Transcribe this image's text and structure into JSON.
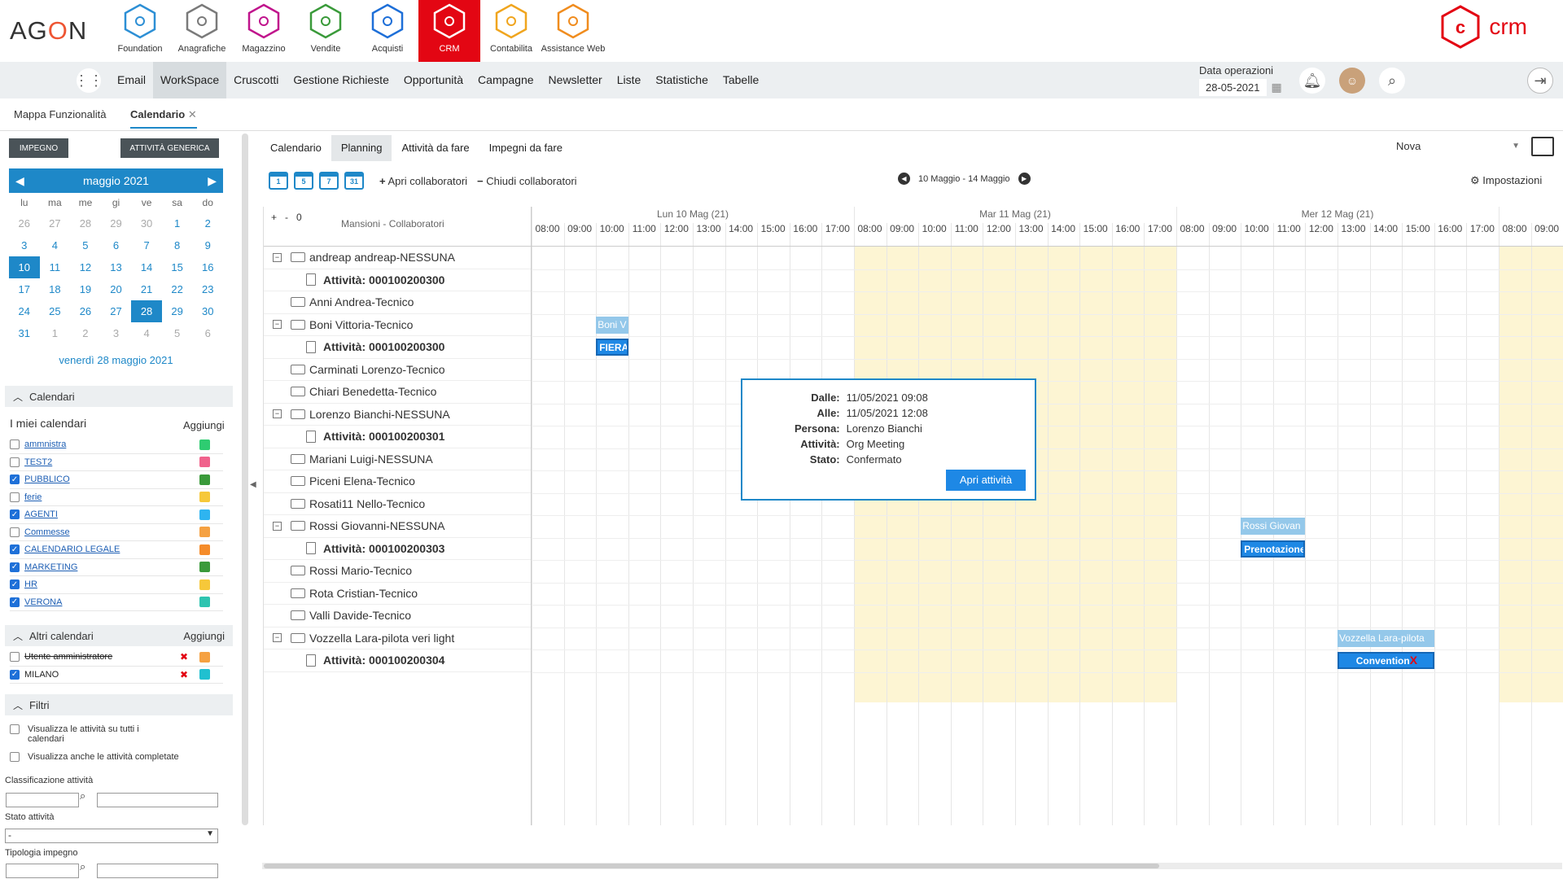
{
  "brand": {
    "logo": "AGON",
    "crm": "crm"
  },
  "modules": [
    {
      "label": "Foundation",
      "color": "#2d8fd5"
    },
    {
      "label": "Anagrafiche",
      "color": "#7a7a7a"
    },
    {
      "label": "Magazzino",
      "color": "#c0148c"
    },
    {
      "label": "Vendite",
      "color": "#3a9a3a"
    },
    {
      "label": "Acquisti",
      "color": "#1e6fd8"
    },
    {
      "label": "CRM",
      "color": "#ffffff"
    },
    {
      "label": "Contabilita",
      "color": "#f0a51e"
    },
    {
      "label": "Assistance Web",
      "color": "#f08c1e"
    }
  ],
  "menu": [
    "Email",
    "WorkSpace",
    "Cruscotti",
    "Gestione Richieste",
    "Opportunità",
    "Campagne",
    "Newsletter",
    "Liste",
    "Statistiche",
    "Tabelle"
  ],
  "data_operazioni": {
    "label": "Data operazioni",
    "value": "28-05-2021"
  },
  "tabs": [
    "Mappa Funzionalità",
    "Calendario"
  ],
  "buttons": {
    "impegno": "IMPEGNO",
    "attivita": "ATTIVITÀ GENERICA"
  },
  "minical": {
    "month": "maggio 2021",
    "daynames": [
      "lu",
      "ma",
      "me",
      "gi",
      "ve",
      "sa",
      "do"
    ],
    "days": [
      "26",
      "27",
      "28",
      "29",
      "30",
      "1",
      "2",
      "3",
      "4",
      "5",
      "6",
      "7",
      "8",
      "9",
      "10",
      "11",
      "12",
      "13",
      "14",
      "15",
      "16",
      "17",
      "18",
      "19",
      "20",
      "21",
      "22",
      "23",
      "24",
      "25",
      "26",
      "27",
      "28",
      "29",
      "30",
      "31",
      "1",
      "2",
      "3",
      "4",
      "5",
      "6"
    ],
    "footer": "venerdì 28 maggio 2021"
  },
  "sections": {
    "calendari": "Calendari",
    "miei": "I miei calendari",
    "aggiungi": "Aggiungi",
    "altri": "Altri calendari",
    "filtri": "Filtri"
  },
  "my_calendars": [
    {
      "name": "ammnistra",
      "checked": false,
      "color": "#2ecc71"
    },
    {
      "name": "TEST2",
      "checked": false,
      "color": "#f0628c"
    },
    {
      "name": "PUBBLICO",
      "checked": true,
      "color": "#3a9a3a"
    },
    {
      "name": "ferie",
      "checked": false,
      "color": "#f6c83a"
    },
    {
      "name": "AGENTI",
      "checked": true,
      "color": "#2eb4f0"
    },
    {
      "name": "Commesse",
      "checked": false,
      "color": "#f5a142"
    },
    {
      "name": "CALENDARIO LEGALE",
      "checked": true,
      "color": "#f58c2a"
    },
    {
      "name": "MARKETING",
      "checked": true,
      "color": "#3a9a3a"
    },
    {
      "name": "HR",
      "checked": true,
      "color": "#f6c83a"
    },
    {
      "name": "VERONA",
      "checked": true,
      "color": "#2ec4b0"
    }
  ],
  "other_calendars": [
    {
      "name": "Utente amministratore",
      "checked": false,
      "color": "#f5a142"
    },
    {
      "name": "MILANO",
      "checked": true,
      "color": "#20c0d0"
    }
  ],
  "filters": {
    "opt1": "Visualizza le attività su tutti i calendari",
    "opt2": "Visualizza anche le attività completate",
    "classificazione": "Classificazione attività",
    "stato": "Stato attività",
    "stato_value": "-",
    "tipologia": "Tipologia impegno"
  },
  "view_tabs": [
    "Calendario",
    "Planning",
    "Attività da fare",
    "Impegni da fare"
  ],
  "nova": "Nova",
  "toolbar": {
    "icons": [
      "1",
      "5",
      "7",
      "31"
    ],
    "apri": "Apri collaboratori",
    "chiudi": "Chiudi collaboratori",
    "week": "10 Maggio - 14 Maggio",
    "impostazioni": "Impostazioni"
  },
  "planning": {
    "header": "Mansioni - Collaboratori",
    "rows": [
      {
        "type": "group",
        "name": "andreap andreap-NESSUNA",
        "exp": true
      },
      {
        "type": "act",
        "name": "Attività: 000100200300"
      },
      {
        "type": "group",
        "name": "Anni Andrea-Tecnico",
        "exp": false
      },
      {
        "type": "group",
        "name": "Boni Vittoria-Tecnico",
        "exp": true
      },
      {
        "type": "act",
        "name": "Attività: 000100200300"
      },
      {
        "type": "group",
        "name": "Carminati Lorenzo-Tecnico",
        "exp": false
      },
      {
        "type": "group",
        "name": "Chiari Benedetta-Tecnico",
        "exp": false
      },
      {
        "type": "group",
        "name": "Lorenzo Bianchi-NESSUNA",
        "exp": true
      },
      {
        "type": "act",
        "name": "Attività: 000100200301"
      },
      {
        "type": "group",
        "name": "Mariani Luigi-NESSUNA",
        "exp": false
      },
      {
        "type": "group",
        "name": "Piceni Elena-Tecnico",
        "exp": false
      },
      {
        "type": "group",
        "name": "Rosati11 Nello-Tecnico",
        "exp": false
      },
      {
        "type": "group",
        "name": "Rossi Giovanni-NESSUNA",
        "exp": true
      },
      {
        "type": "act",
        "name": "Attività: 000100200303"
      },
      {
        "type": "group",
        "name": "Rossi Mario-Tecnico",
        "exp": false
      },
      {
        "type": "group",
        "name": "Rota Cristian-Tecnico",
        "exp": false
      },
      {
        "type": "group",
        "name": "Valli Davide-Tecnico",
        "exp": false
      },
      {
        "type": "group",
        "name": "Vozzella Lara-pilota veri light",
        "exp": true
      },
      {
        "type": "act",
        "name": "Attività: 000100200304"
      }
    ],
    "days": [
      "Lun 10 Mag (21)",
      "Mar 11 Mag (21)",
      "Mer 12 Mag (21)"
    ],
    "hours": [
      "08:00",
      "09:00",
      "10:00",
      "11:00",
      "12:00",
      "13:00",
      "14:00",
      "15:00",
      "16:00",
      "17:00"
    ],
    "events": [
      {
        "row": 3,
        "day": 0,
        "start": 10.0,
        "end": 11.0,
        "style": "light",
        "label": "Boni V"
      },
      {
        "row": 4,
        "day": 0,
        "start": 10.0,
        "end": 11.0,
        "style": "dark",
        "label": "FIERA"
      },
      {
        "row": 7,
        "day": 1,
        "start": 9.13,
        "end": 12.13,
        "style": "light",
        "label": "Lorenzo Bianchi-NE"
      },
      {
        "row": 8,
        "day": 1,
        "start": 9.13,
        "end": 12.13,
        "style": "dark",
        "label": "Org Meeting"
      },
      {
        "row": 12,
        "day": 2,
        "start": 10.0,
        "end": 12.0,
        "style": "light",
        "label": "Rossi Giovan"
      },
      {
        "row": 13,
        "day": 2,
        "start": 10.0,
        "end": 12.0,
        "style": "dark",
        "label": "Prenotazione"
      },
      {
        "row": 17,
        "day": 2,
        "start": 13.0,
        "end": 16.0,
        "style": "light",
        "label": "Vozzella Lara-pilota"
      },
      {
        "row": 18,
        "day": 2,
        "start": 13.0,
        "end": 16.0,
        "style": "dark",
        "label": "Convention"
      }
    ]
  },
  "popup": {
    "dalle_k": "Dalle:",
    "dalle": "11/05/2021 09:08",
    "alle_k": "Alle:",
    "alle": "11/05/2021 12:08",
    "persona_k": "Persona:",
    "persona": "Lorenzo Bianchi",
    "attivita_k": "Attività:",
    "attivita": "Org Meeting",
    "stato_k": "Stato:",
    "stato": "Confermato",
    "button": "Apri attività"
  }
}
